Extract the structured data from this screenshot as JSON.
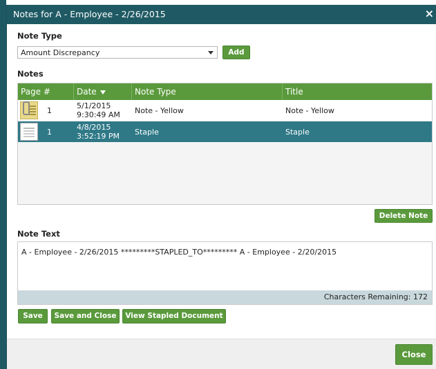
{
  "dialog": {
    "title": "Notes for A - Employee - 2/26/2015",
    "close_glyph": "×"
  },
  "note_type": {
    "label": "Note Type",
    "selected": "Amount Discrepancy",
    "add_label": "Add"
  },
  "notes": {
    "label": "Notes",
    "columns": [
      "Page #",
      "Date",
      "Note Type",
      "Title"
    ],
    "rows": [
      {
        "icon": "sticky-note-thumbnail-icon",
        "page": "1",
        "date_line1": "5/1/2015",
        "date_line2": "9:30:49 AM",
        "note_type": "Note - Yellow",
        "title": "Note - Yellow"
      },
      {
        "icon": "stapled-document-thumbnail-icon",
        "page": "1",
        "date_line1": "4/8/2015",
        "date_line2": "3:52:19 PM",
        "note_type": "Staple",
        "title": "Staple"
      }
    ],
    "delete_label": "Delete Note"
  },
  "note_text": {
    "label": "Note Text",
    "value": "A - Employee - 2/26/2015 *********STAPLED_TO********* A - Employee - 2/20/2015",
    "chars_remaining": "Characters Remaining: 172"
  },
  "actions": {
    "save": "Save",
    "save_close": "Save and Close",
    "view_stapled": "View Stapled Document",
    "close": "Close"
  },
  "colors": {
    "title_bar": "#1f5a64",
    "button_green": "#5a9a3c",
    "selected_row": "#2f7987"
  }
}
